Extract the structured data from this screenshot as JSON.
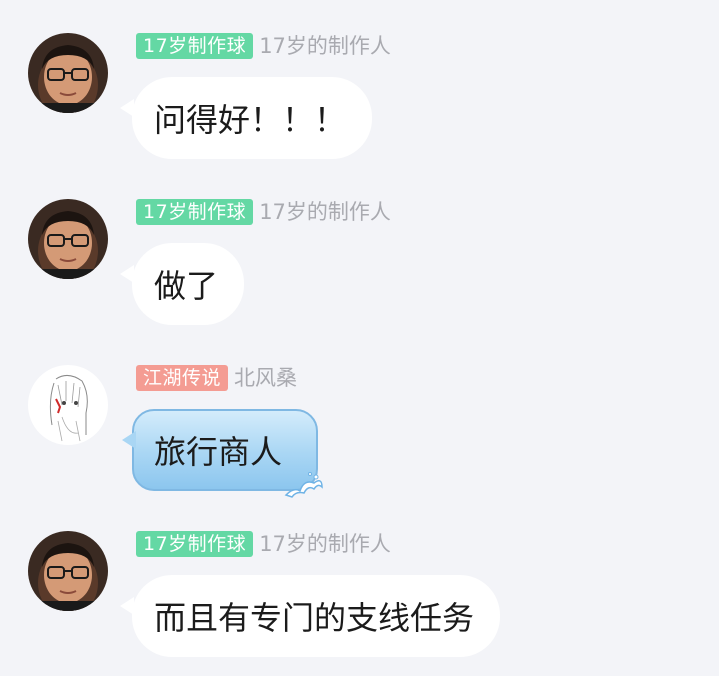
{
  "messages": [
    {
      "tag": "17岁制作球",
      "tag_color": "#64d8a4",
      "nickname": "17岁的制作人",
      "text": "问得好！！！",
      "avatar": "man-glasses-avatar"
    },
    {
      "tag": "17岁制作球",
      "tag_color": "#64d8a4",
      "nickname": "17岁的制作人",
      "text": "做了",
      "avatar": "man-glasses-avatar"
    },
    {
      "tag": "江湖传说",
      "tag_color": "#f49c93",
      "nickname": "北风桑",
      "text": "旅行商人",
      "avatar": "anime-sketch-avatar"
    },
    {
      "tag": "17岁制作球",
      "tag_color": "#64d8a4",
      "nickname": "17岁的制作人",
      "text": "而且有专门的支线任务",
      "avatar": "man-glasses-avatar"
    }
  ]
}
